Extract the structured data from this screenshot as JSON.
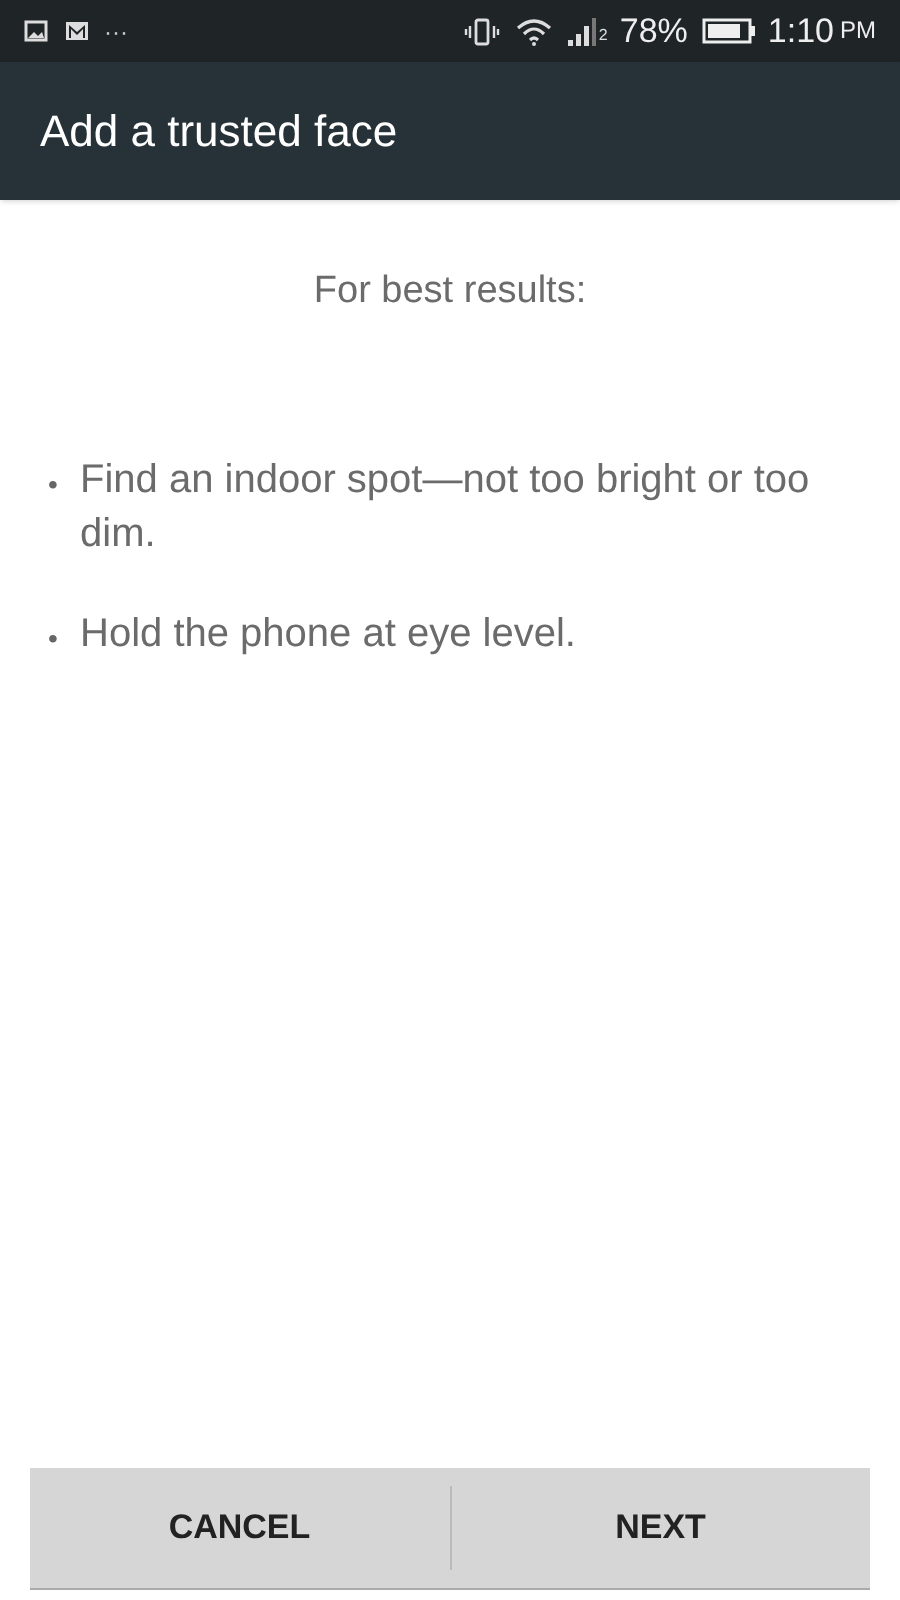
{
  "status_bar": {
    "more": "···",
    "sim": "2",
    "battery": "78%",
    "time": "1:10",
    "ampm": "PM"
  },
  "app_bar": {
    "title": "Add a trusted face"
  },
  "heading": "For best results:",
  "tips": [
    "Find an indoor spot—not too bright or too dim.",
    "Hold the phone at eye level."
  ],
  "bullet": "•",
  "buttons": [
    "CANCEL",
    "NEXT"
  ]
}
